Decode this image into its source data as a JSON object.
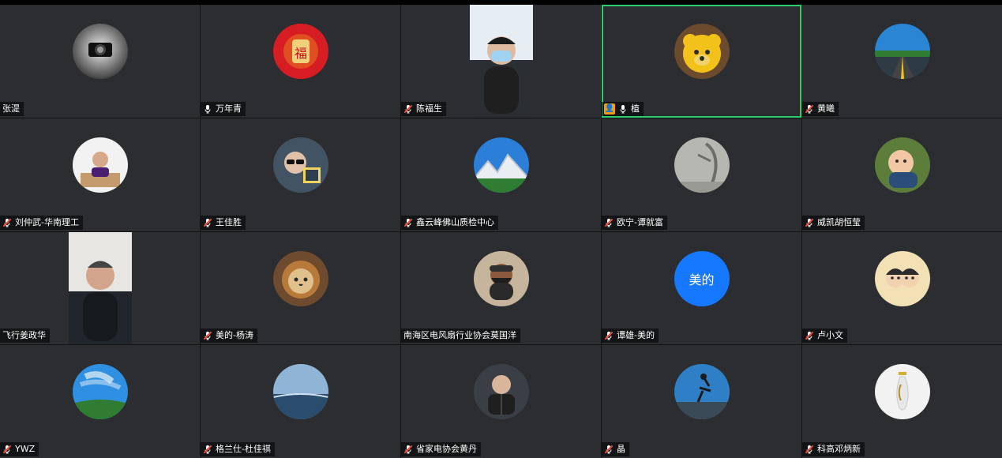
{
  "participants": [
    {
      "name": "张湜",
      "mic": "none",
      "avatar": "photo-camera-bw",
      "active": false,
      "badge": false
    },
    {
      "name": "万年青",
      "mic": "on",
      "avatar": "fu-red-ornament",
      "active": false,
      "badge": false
    },
    {
      "name": "陈福生",
      "mic": "off",
      "avatar": "video-man-mask",
      "active": false,
      "badge": false
    },
    {
      "name": "植",
      "mic": "on",
      "avatar": "yellow-bear",
      "active": true,
      "badge": true
    },
    {
      "name": "黄曦",
      "mic": "off",
      "avatar": "road-sky",
      "active": false,
      "badge": false
    },
    {
      "name": "刘仲武-华南理工",
      "mic": "off",
      "avatar": "man-desk",
      "active": false,
      "badge": false
    },
    {
      "name": "王佳胜",
      "mic": "off",
      "avatar": "selfie-glasses",
      "active": false,
      "badge": false
    },
    {
      "name": "鑫云峰佛山质检中心",
      "mic": "off",
      "avatar": "mountain",
      "active": false,
      "badge": false
    },
    {
      "name": "欧宁-谭就富",
      "mic": "off",
      "avatar": "sculpture-grey",
      "active": false,
      "badge": false
    },
    {
      "name": "威凯胡恒莹",
      "mic": "off",
      "avatar": "baby",
      "active": false,
      "badge": false
    },
    {
      "name": "飞行姜政华",
      "mic": "none",
      "avatar": "video-man-dark",
      "active": false,
      "badge": false
    },
    {
      "name": "美的-杨涛",
      "mic": "off",
      "avatar": "lion-cat",
      "active": false,
      "badge": false
    },
    {
      "name": "南海区电风扇行业协会莫国洋",
      "mic": "none",
      "avatar": "man-beard",
      "active": false,
      "badge": false
    },
    {
      "name": "谭雄-美的",
      "mic": "off",
      "avatar": "text",
      "avatarText": "美的",
      "active": false,
      "badge": false
    },
    {
      "name": "卢小文",
      "mic": "off",
      "avatar": "cartoon-couple",
      "active": false,
      "badge": false
    },
    {
      "name": "YWZ",
      "mic": "off",
      "avatar": "tree-sky",
      "active": false,
      "badge": false
    },
    {
      "name": "格兰仕-杜佳祺",
      "mic": "off",
      "avatar": "sea-sky",
      "active": false,
      "badge": false
    },
    {
      "name": "省家电协会黄丹",
      "mic": "off",
      "avatar": "man-shirt",
      "active": false,
      "badge": false
    },
    {
      "name": "晶",
      "mic": "off",
      "avatar": "yoga-silhouette",
      "active": false,
      "badge": false
    },
    {
      "name": "科高邓炳新",
      "mic": "off",
      "avatar": "vase-white",
      "active": false,
      "badge": false
    }
  ],
  "colors": {
    "tile_bg": "#2b2d30",
    "active_border": "#2ecc71",
    "mic_muted": "#e74c3c",
    "avatar_text_bg": "#1677ff",
    "badge_bg": "#f39c12"
  },
  "icons": {
    "mic_on": "microphone-icon",
    "mic_off": "microphone-muted-icon",
    "badge": "host-person-icon"
  }
}
